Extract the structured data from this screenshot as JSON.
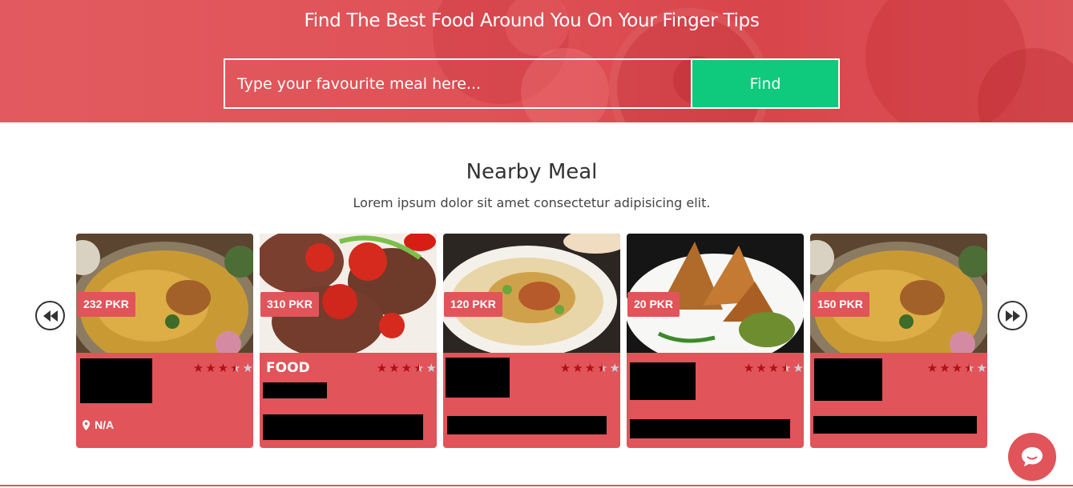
{
  "hero": {
    "title": "Find The Best Food Around You On Your Finger Tips",
    "search_placeholder": "Type your favourite meal here...",
    "find_label": "Find"
  },
  "section": {
    "title": "Nearby Meal",
    "subtitle": "Lorem ipsum dolor sit amet consectetur adipisicing elit."
  },
  "carousel": {
    "prev_icon": "rewind-icon",
    "next_icon": "fast-forward-icon",
    "cards": [
      {
        "price": "232 PKR",
        "image": "biryani-plate",
        "name": "",
        "rating": 3.5,
        "rating_max": 5,
        "location": "N/A"
      },
      {
        "price": "310 PKR",
        "image": "kebab-patties-with-tomato",
        "name": "FOOD",
        "rating": 3.5,
        "rating_max": 5,
        "location": ""
      },
      {
        "price": "120 PKR",
        "image": "rice-platter",
        "name": "",
        "rating": 3.5,
        "rating_max": 5,
        "location": ""
      },
      {
        "price": "20 PKR",
        "image": "samosa-with-chutney",
        "name": "",
        "rating": 3.5,
        "rating_max": 5,
        "location": ""
      },
      {
        "price": "150 PKR",
        "image": "biryani-plate",
        "name": "",
        "rating": 3.5,
        "rating_max": 5,
        "location": ""
      }
    ]
  },
  "chat": {
    "icon": "chat-bubble-icon"
  },
  "colors": {
    "brand": "#e0545a",
    "accent": "#0fc97c",
    "star": "#b01016",
    "star_empty": "#c9d2e0"
  }
}
